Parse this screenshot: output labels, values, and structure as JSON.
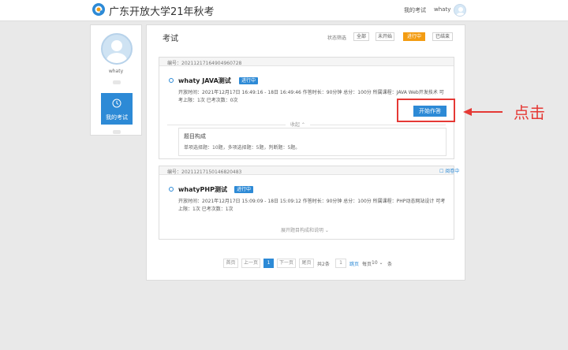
{
  "header": {
    "site_title": "广东开放大学21年秋考",
    "my_exam": "我的考试",
    "username": "whaty"
  },
  "sidebar": {
    "username": "whaty",
    "menu_item": "我的考试"
  },
  "main": {
    "title": "考试",
    "filter_label": "状态筛选",
    "filters": [
      "全部",
      "未开始",
      "进行中",
      "已结束"
    ],
    "active_filter": "进行中"
  },
  "exams": [
    {
      "number": "编号：20211217164904960728",
      "name": "whaty JAVA测试",
      "status": "进行中",
      "meta_line1": "开放时间：2021年12月17日 16:49:16 - 18日 16:49:46 作答时长：90分钟 总分：100分 所属课程：JAVA Web开发技术   可",
      "meta_line2": "考上限：1次 已考次数：0次",
      "start_button": "开始作答",
      "collapse_text": "收起 ⌃",
      "composition_title": "题目构成",
      "composition_detail": "单项选择题：10题，多项选择题：5题，判断题：5题。"
    },
    {
      "number": "编号：20211217150146820483",
      "name": "whatyPHP测试",
      "status": "进行中",
      "review_tag": "阅卷中",
      "meta_line1": "开放时间：2021年12月17日 15:09:09 - 18日 15:09:12 作答时长：90分钟 总分：100分 所属课程：PHP动态网站设计   可考",
      "meta_line2": "上限：1次 已考次数：1次",
      "expand_text": "展开题目构成和说明 ⌄"
    }
  ],
  "pagination": {
    "first": "首页",
    "prev": "上一页",
    "current_page": "1",
    "next": "下一页",
    "last": "尾页",
    "total": "共2条",
    "page_input": "1",
    "go": "跳页",
    "per_page_label": "每页",
    "per_page_value": "10 ⌄",
    "per_page_unit": "条"
  },
  "annotation": {
    "callout": "点击",
    "color": "#e53935"
  },
  "colors": {
    "primary": "#2d8ad6",
    "active_filter": "#f39c12"
  }
}
